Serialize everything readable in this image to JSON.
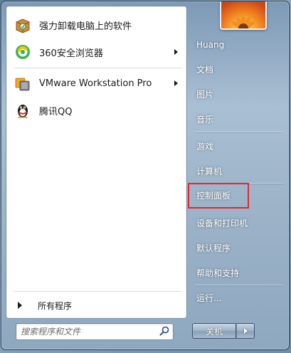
{
  "programs": [
    {
      "label": "强力卸载电脑上的软件",
      "icon": "uninstaller-box-icon",
      "has_submenu": false
    },
    {
      "label": "360安全浏览器",
      "icon": "360-browser-icon",
      "has_submenu": true
    },
    {
      "label": "VMware Workstation Pro",
      "icon": "vmware-icon",
      "has_submenu": true
    },
    {
      "label": "腾讯QQ",
      "icon": "qq-penguin-icon",
      "has_submenu": false
    }
  ],
  "all_programs_label": "所有程序",
  "search": {
    "placeholder": "搜索程序和文件"
  },
  "places": [
    {
      "label": "Huang"
    },
    {
      "label": "文档"
    },
    {
      "label": "图片"
    },
    {
      "label": "音乐"
    },
    {
      "label": "游戏"
    },
    {
      "label": "计算机"
    },
    {
      "label": "控制面板",
      "highlighted": true
    },
    {
      "label": "设备和打印机"
    },
    {
      "label": "默认程序"
    },
    {
      "label": "帮助和支持"
    },
    {
      "label": "运行..."
    }
  ],
  "shutdown": {
    "label": "关机"
  },
  "colors": {
    "highlight_border": "#e5262c",
    "menu_frame": "#9cb3c8"
  }
}
